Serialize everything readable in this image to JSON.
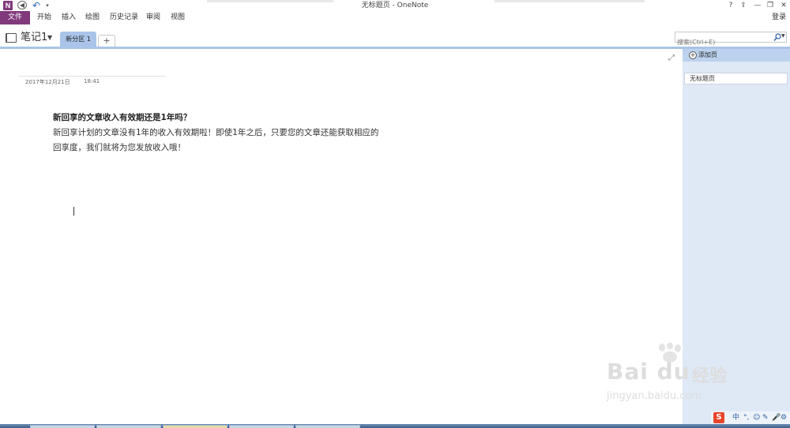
{
  "titlebar": {
    "app_icon": "N",
    "title": "无标题页 - OneNote",
    "controls": [
      "?",
      "⇪",
      "—",
      "❐",
      "✕"
    ]
  },
  "ribbon": {
    "file_tab": "文件",
    "tabs": [
      "开始",
      "插入",
      "绘图",
      "历史记录",
      "审阅",
      "视图"
    ],
    "sign_in": "登录"
  },
  "notebook": {
    "name": "笔记1",
    "section_tab": "新分区 1",
    "add_section": "+"
  },
  "search": {
    "placeholder": "搜索(Ctrl+E)"
  },
  "page": {
    "date": "2017年12月21日",
    "time": "18:41",
    "heading": "新回享的文章收入有效期还是1年吗？",
    "paragraph": "新回享计划的文章没有1年的收入有效期啦！即使1年之后，只要您的文章还能获取相应的回享度，我们就将为您发放收入哦！"
  },
  "pages_pane": {
    "add_page": "添加页",
    "items": [
      "无标题页"
    ]
  },
  "watermark": {
    "brand": "Bai du",
    "cn": "经验",
    "url": "jingyan.baidu.com"
  },
  "tray": {
    "ime": "S",
    "items": [
      "中",
      "°,",
      "☺",
      "✎",
      "🎤",
      "⚙"
    ]
  }
}
